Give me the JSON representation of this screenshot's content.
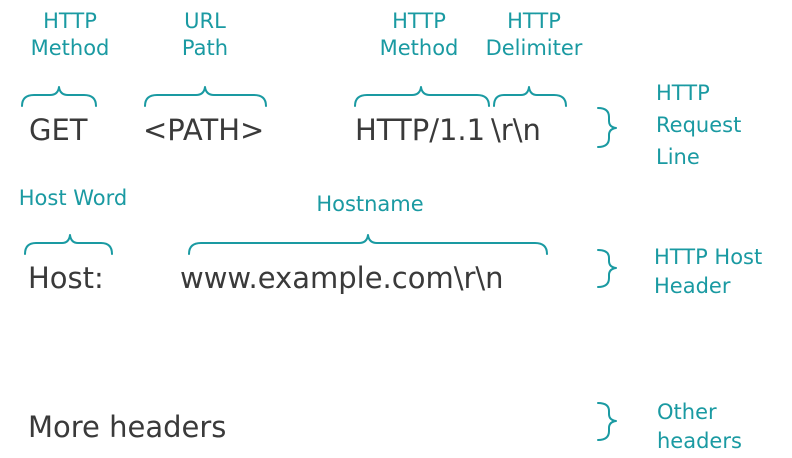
{
  "diagram": {
    "request_line": {
      "labels": {
        "method": [
          "HTTP",
          "Method"
        ],
        "url_path": [
          "URL",
          "Path"
        ],
        "version": [
          "HTTP",
          "Method"
        ],
        "delimiter": [
          "HTTP",
          "Delimiter"
        ]
      },
      "tokens": {
        "method": "GET",
        "path": "<PATH>",
        "version": "HTTP/1.1",
        "delimiter": "\\r\\n"
      },
      "group_label": [
        "HTTP",
        "Request",
        "Line"
      ]
    },
    "host_header": {
      "labels": {
        "host_word": "Host Word",
        "hostname": "Hostname"
      },
      "tokens": {
        "host": "Host:",
        "hostname": "www.example.com\\r\\n"
      },
      "group_label": [
        "HTTP Host",
        "Header"
      ]
    },
    "other": {
      "text": "More headers",
      "group_label": [
        "Other",
        "headers"
      ]
    },
    "colors": {
      "accent": "#1a9aa2",
      "text": "#3a3a3a"
    }
  }
}
